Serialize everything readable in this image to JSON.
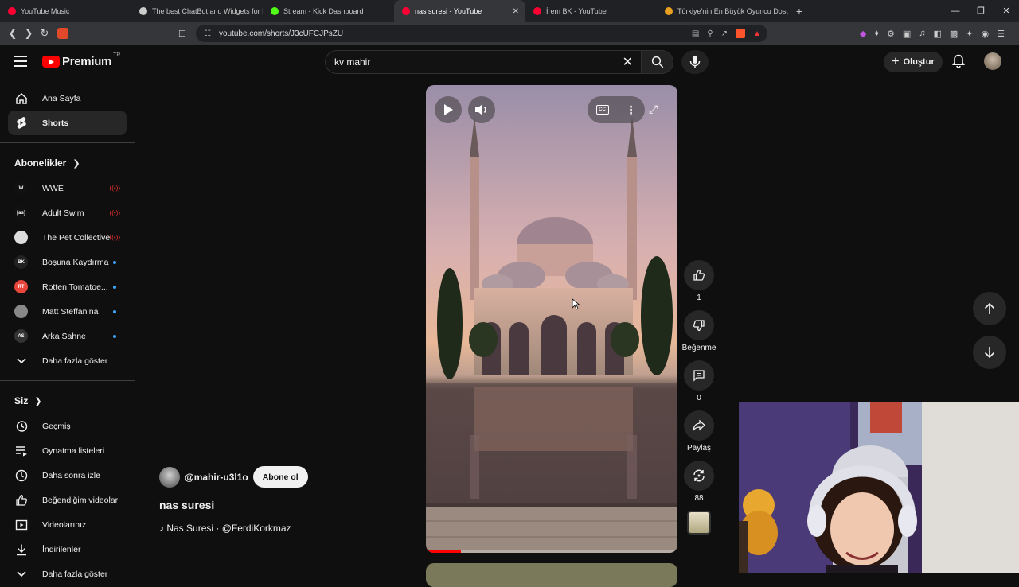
{
  "browser": {
    "tabs": [
      {
        "title": "YouTube Music",
        "fav_color": "#ff0033"
      },
      {
        "title": "The best ChatBot and Widgets for Ki",
        "fav_color": "#cccccc"
      },
      {
        "title": "Stream - Kick Dashboard",
        "fav_color": "#53fc18"
      },
      {
        "title": "nas suresi - YouTube",
        "fav_color": "#ff0033",
        "active": true
      },
      {
        "title": "İrem BK - YouTube",
        "fav_color": "#ff0033"
      },
      {
        "title": "Türkiye'nin En Büyük Oyuncu Dostu",
        "fav_color": "#e8a020"
      }
    ],
    "url": "youtube.com/shorts/J3cUFCJPsZU"
  },
  "masthead": {
    "logo_text": "Premium",
    "region": "TR",
    "search_value": "kv mahir",
    "create_label": "Oluştur"
  },
  "sidebar": {
    "main": [
      {
        "label": "Ana Sayfa",
        "icon": "home-icon"
      },
      {
        "label": "Shorts",
        "icon": "shorts-icon",
        "active": true
      }
    ],
    "subscriptions_title": "Abonelikler",
    "subscriptions": [
      {
        "label": "WWE",
        "badge": "live",
        "color": "#111111",
        "abbr": "W"
      },
      {
        "label": "Adult Swim",
        "badge": "live",
        "color": "#111111",
        "abbr": "[as]"
      },
      {
        "label": "The Pet Collective",
        "badge": "live",
        "color": "#dddddd",
        "abbr": ""
      },
      {
        "label": "Boşuna Kaydırma",
        "badge": "new",
        "color": "#222222",
        "abbr": "BK"
      },
      {
        "label": "Rotten Tomatoe...",
        "badge": "new",
        "color": "#e8453c",
        "abbr": "RT"
      },
      {
        "label": "Matt Steffanina",
        "badge": "new",
        "color": "#888888",
        "abbr": ""
      },
      {
        "label": "Arka Sahne",
        "badge": "new",
        "color": "#333333",
        "abbr": "AS"
      }
    ],
    "show_more_subs": "Daha fazla göster",
    "you_title": "Siz",
    "you_items": [
      {
        "label": "Geçmiş",
        "icon": "history-icon"
      },
      {
        "label": "Oynatma listeleri",
        "icon": "playlist-icon"
      },
      {
        "label": "Daha sonra izle",
        "icon": "watch-later-icon"
      },
      {
        "label": "Beğendiğim videolar",
        "icon": "liked-icon"
      },
      {
        "label": "Videolarınız",
        "icon": "your-videos-icon"
      },
      {
        "label": "İndirilenler",
        "icon": "download-icon"
      }
    ],
    "show_more_you": "Daha fazla göster"
  },
  "short": {
    "channel": "@mahir-u3l1o",
    "subscribe_label": "Abone ol",
    "title": "nas suresi",
    "music": "Nas Suresi · @FerdiKorkmaz",
    "progress": 0.14
  },
  "actions": {
    "like_count": "1",
    "dislike_label": "Beğenme",
    "comment_count": "0",
    "share_label": "Paylaş",
    "remix_count": "88"
  }
}
